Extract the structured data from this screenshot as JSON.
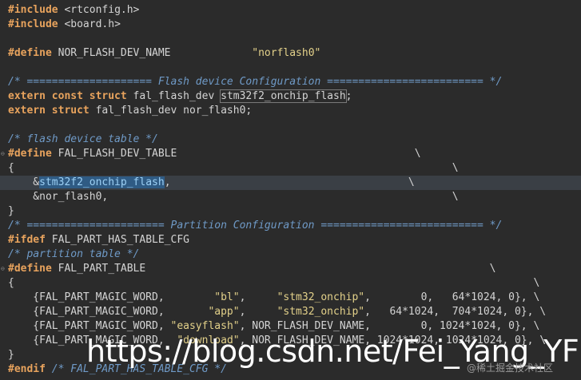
{
  "editor": {
    "lines": [
      {
        "k": "#include",
        "rest": " <rtconfig.h>"
      },
      {
        "k": "#include",
        "rest": " <board.h>"
      },
      {
        "text": ""
      },
      {
        "k": "#define",
        "name": " NOR_FLASH_DEV_NAME",
        "pad": "             ",
        "str": "\"norflash0\""
      },
      {
        "text": ""
      },
      {
        "comment": "/* ==================== Flash device Configuration ========================= */"
      },
      {
        "k": "extern const struct",
        "rest": " fal_flash_dev ",
        "box": "stm32f2_onchip_flash",
        "tail": ";"
      },
      {
        "k": "extern struct",
        "rest": " fal_flash_dev nor_flash0;"
      },
      {
        "text": ""
      },
      {
        "comment": "/* flash device table */"
      },
      {
        "k": "#define",
        "rest": " FAL_FLASH_DEV_TABLE",
        "tail": "                                      \\"
      },
      {
        "text": "{                                                                      \\"
      },
      {
        "pre": "    &",
        "sel": "stm32f2_onchip_flash",
        "tail": ",                                      \\"
      },
      {
        "text": "    &nor_flash0,                                                       \\"
      },
      {
        "text": "}"
      },
      {
        "comment": "/* ====================== Partition Configuration ========================== */"
      },
      {
        "k": "#ifdef",
        "rest": " FAL_PART_HAS_TABLE_CFG"
      },
      {
        "comment": "/* partition table */"
      },
      {
        "k": "#define",
        "rest": " FAL_PART_TABLE",
        "tail": "                                                       \\"
      },
      {
        "text": "{                                                                                   \\"
      },
      {
        "text": "    {FAL_PART_MAGIC_WORD,        ",
        "s1": "\"bl\"",
        "m1": ",     ",
        "s2": "\"stm32_onchip\"",
        "end": ",        0,   64*1024, 0}, \\"
      },
      {
        "text": "    {FAL_PART_MAGIC_WORD,       ",
        "s1": "\"app\"",
        "m1": ",     ",
        "s2": "\"stm32_onchip\"",
        "end": ",   64*1024,  704*1024, 0}, \\"
      },
      {
        "text": "    {FAL_PART_MAGIC_WORD, ",
        "s1": "\"easyflash\"",
        "m1": ", NOR_FLASH_DEV_NAME,",
        "end": "        0, 1024*1024, 0}, \\"
      },
      {
        "text": "    {FAL_PART_MAGIC_WORD,  ",
        "s1": "\"download\"",
        "m1": ", NOR_FLASH_DEV_NAME, ",
        "end": "1024*1024, 1024*1024, 0}, \\"
      },
      {
        "text": "}"
      },
      {
        "k": "#endif",
        "comment_tail": " /* FAL_PART_HAS_TABLE_CFG */"
      }
    ]
  },
  "watermark": {
    "url": "https://blog.csdn.net/Fei_Yang_YF",
    "site": "@稀土掘金技术社区"
  },
  "colors": {
    "background": "#2b2b2b",
    "keyword": "#e8a35d",
    "string": "#e3d18a",
    "comment": "#6f9ac7",
    "selection": "#2f5b84"
  }
}
